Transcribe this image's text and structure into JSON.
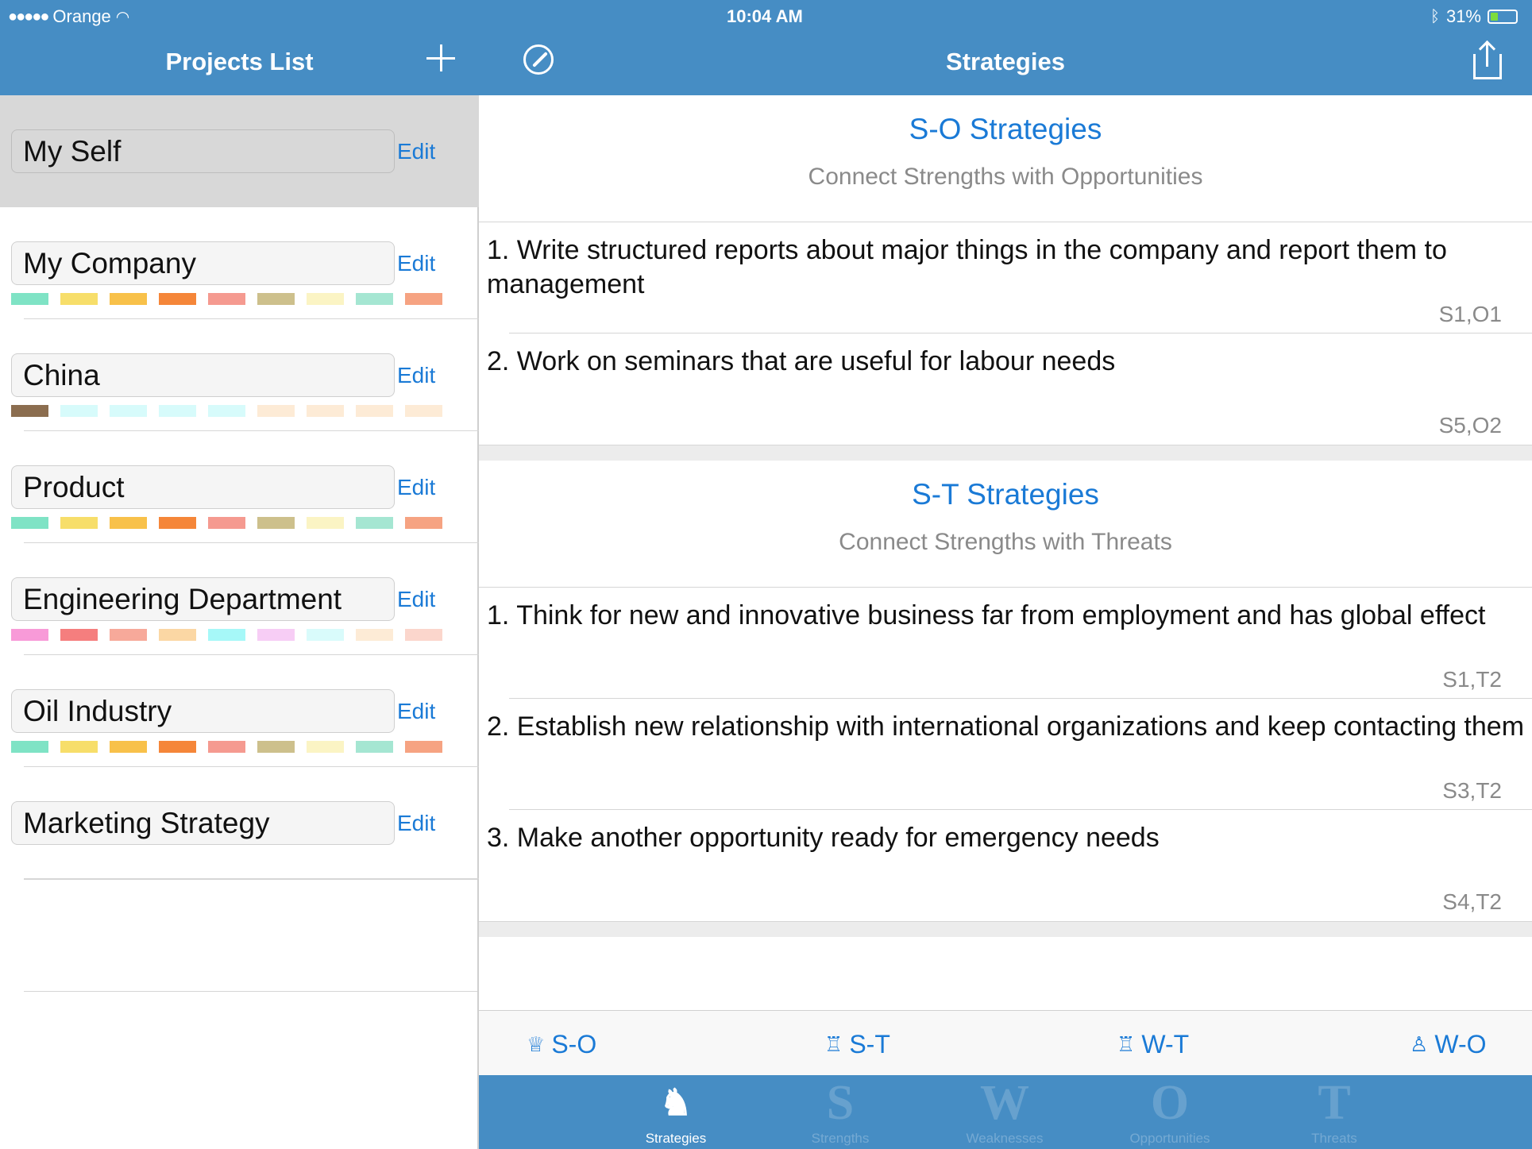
{
  "status": {
    "carrier": "Orange",
    "time": "10:04 AM",
    "battery_percent": "31%",
    "battery_level": 0.31,
    "battery_color": "#7ddc3c"
  },
  "left": {
    "title": "Projects List",
    "add_icon": "plus-icon",
    "edit_label": "Edit",
    "projects": [
      {
        "name": "My Self",
        "selected": true,
        "colors": []
      },
      {
        "name": "My Company",
        "colors": [
          "#7fe3c5",
          "#f7de6a",
          "#f8c14a",
          "#f58639",
          "#f59a90",
          "#cdc08c",
          "#fbf4c4",
          "#a5e6d2",
          "#f6a382"
        ]
      },
      {
        "name": "China",
        "colors": [
          "#8b6d4f",
          "#d7fbfb",
          "#d7fbfb",
          "#d7fbfb",
          "#d7fbfb",
          "#fdebd6",
          "#fdebd6",
          "#fdebd6",
          "#fdebd6"
        ]
      },
      {
        "name": "Product",
        "colors": [
          "#7fe3c5",
          "#f7de6a",
          "#f8c14a",
          "#f58639",
          "#f59a90",
          "#cdc08c",
          "#fbf4c4",
          "#a5e6d2",
          "#f6a382"
        ]
      },
      {
        "name": "Engineering Department",
        "colors": [
          "#f89ad8",
          "#f57e7e",
          "#f7a99a",
          "#fbd7a4",
          "#a6f8f8",
          "#f7cdf5",
          "#d9fbfb",
          "#fdebd6",
          "#fbd6cc"
        ]
      },
      {
        "name": "Oil Industry",
        "colors": [
          "#7fe3c5",
          "#f7de6a",
          "#f8c14a",
          "#f58639",
          "#f59a90",
          "#cdc08c",
          "#fbf4c4",
          "#a5e6d2",
          "#f6a382"
        ]
      },
      {
        "name": "Marketing Strategy",
        "colors": []
      }
    ]
  },
  "right": {
    "title": "Strategies",
    "nav_left_icon": "compass-icon",
    "nav_right_icon": "share-icon",
    "sections": [
      {
        "title": "S-O Strategies",
        "subtitle": "Connect Strengths with Opportunities",
        "items": [
          {
            "text": "1. Write structured reports about major things in the company and report them to management",
            "code": "S1,O1"
          },
          {
            "text": "2. Work on seminars that are useful for labour needs",
            "code": "S5,O2"
          }
        ]
      },
      {
        "title": "S-T Strategies",
        "subtitle": "Connect Strengths with Threats",
        "items": [
          {
            "text": "1. Think for new and innovative business far from employment and has global effect",
            "code": "S1,T2"
          },
          {
            "text": "2. Establish new relationship with international organizations and keep contacting them",
            "code": "S3,T2"
          },
          {
            "text": "3. Make another opportunity ready for emergency needs",
            "code": "S4,T2"
          }
        ]
      }
    ],
    "segments": [
      {
        "label": "S-O",
        "icon": "crown-icon",
        "glyph": "♕"
      },
      {
        "label": "S-T",
        "icon": "rook-icon",
        "glyph": "♖"
      },
      {
        "label": "W-T",
        "icon": "rook-icon",
        "glyph": "♖"
      },
      {
        "label": "W-O",
        "icon": "pawn-icon",
        "glyph": "♙"
      }
    ],
    "tabs": [
      {
        "label": "Strategies",
        "icon_text": "♞",
        "active": true
      },
      {
        "label": "Strengths",
        "icon_text": "S"
      },
      {
        "label": "Weaknesses",
        "icon_text": "W"
      },
      {
        "label": "Opportunities",
        "icon_text": "O"
      },
      {
        "label": "Threats",
        "icon_text": "T"
      }
    ]
  }
}
